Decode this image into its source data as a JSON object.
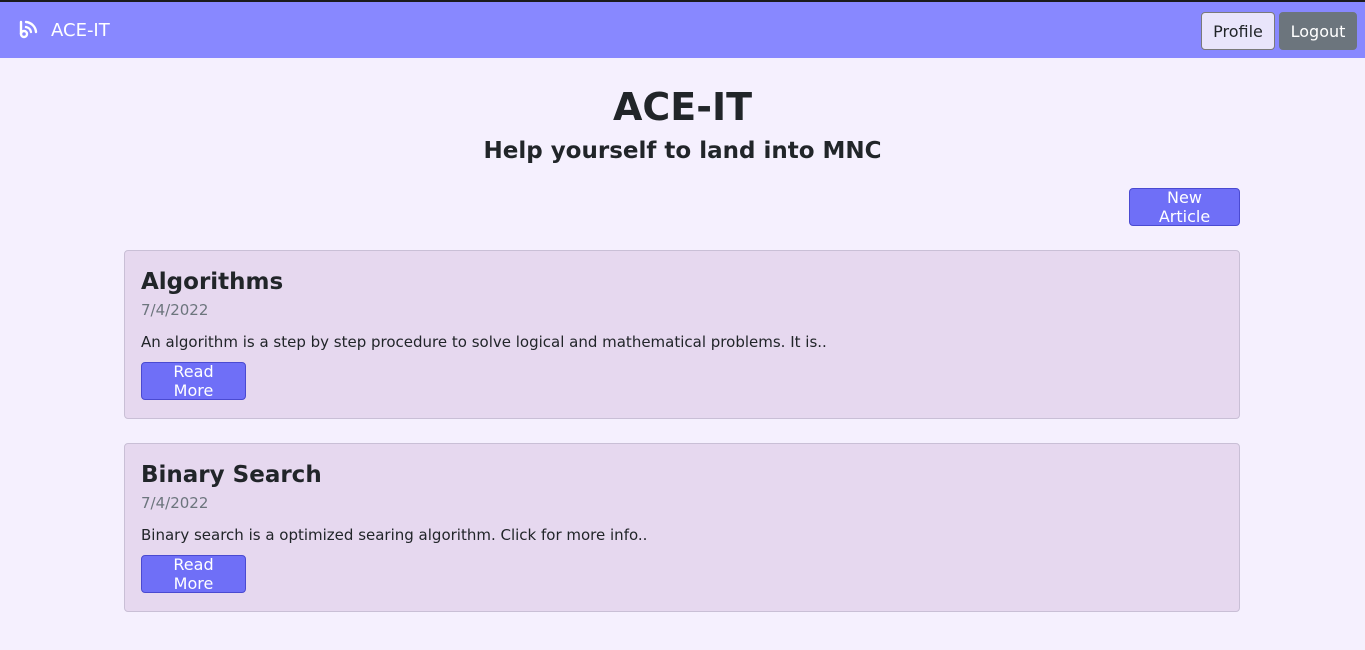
{
  "navbar": {
    "brand": "ACE-IT",
    "brand_icon": "wifi-signal-icon",
    "profile_label": "Profile",
    "logout_label": "Logout",
    "bg_color": "#8888ff"
  },
  "hero": {
    "title": "ACE-IT",
    "subtitle": "Help yourself to land into MNC"
  },
  "actions": {
    "new_article_label": "New Article"
  },
  "articles": [
    {
      "title": "Algorithms",
      "date": "7/4/2022",
      "excerpt": "An algorithm is a step by step procedure to solve logical and mathematical problems. It is..",
      "button_label": "Read More"
    },
    {
      "title": "Binary Search",
      "date": "7/4/2022",
      "excerpt": "Binary search is a optimized searing algorithm. Click for more info..",
      "button_label": "Read More"
    }
  ]
}
